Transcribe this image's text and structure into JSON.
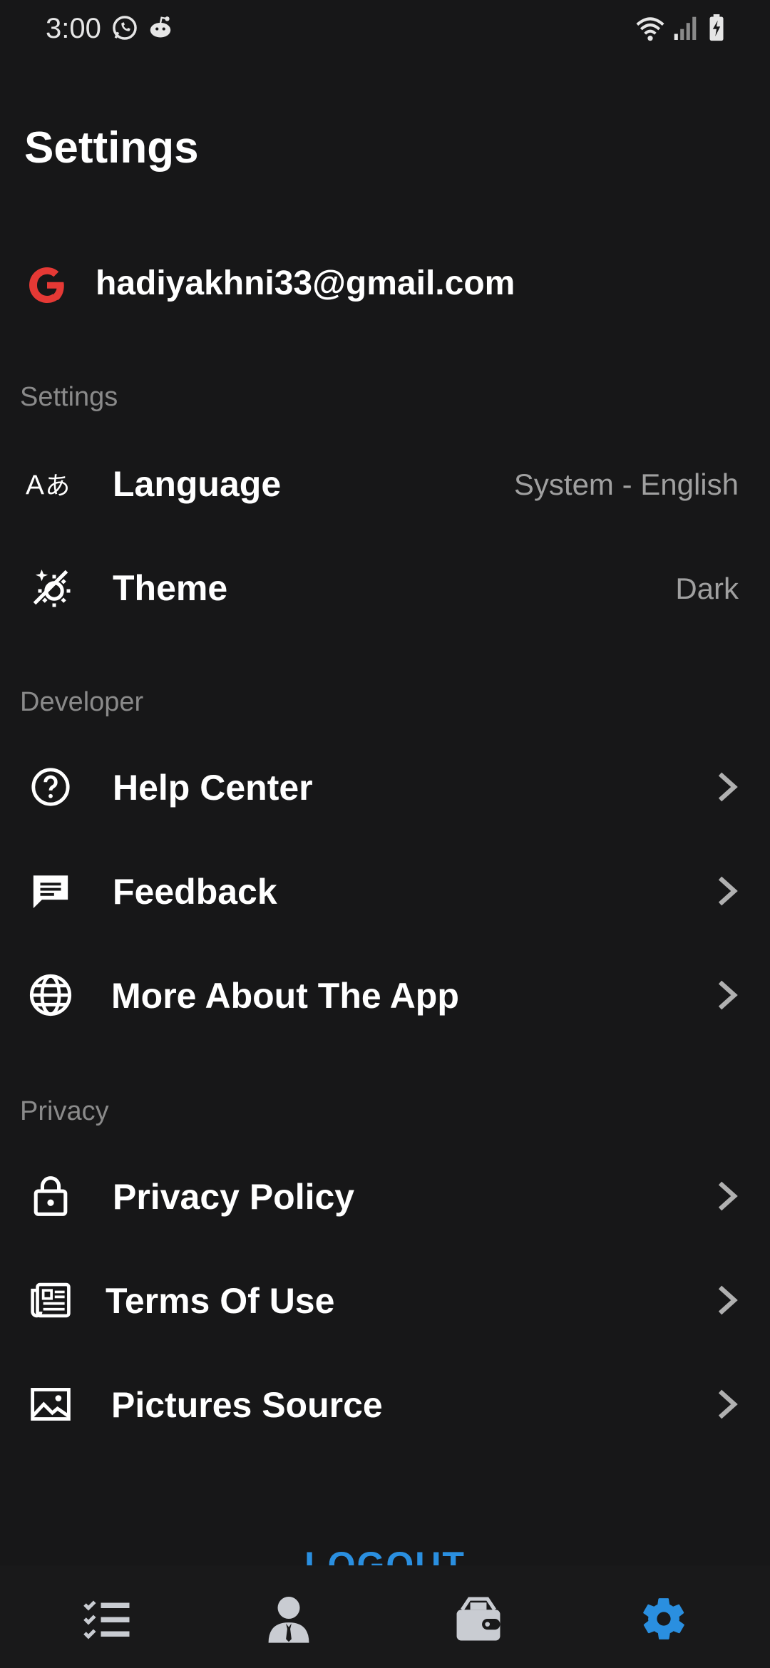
{
  "status_bar": {
    "time": "3:00",
    "left_icons": [
      "whatsapp-icon",
      "reddit-icon"
    ],
    "right_icons": [
      "wifi-icon",
      "signal-icon",
      "battery-charging-icon"
    ]
  },
  "page": {
    "title": "Settings"
  },
  "account": {
    "provider_icon": "google-icon",
    "email": "hadiyakhni33@gmail.com"
  },
  "sections": {
    "settings": {
      "label": "Settings",
      "items": [
        {
          "label": "Language",
          "value": "System - English",
          "icon": "translate-icon"
        },
        {
          "label": "Theme",
          "value": "Dark",
          "icon": "theme-icon"
        }
      ]
    },
    "developer": {
      "label": "Developer",
      "items": [
        {
          "label": "Help Center",
          "icon": "help-circle-icon"
        },
        {
          "label": "Feedback",
          "icon": "feedback-icon"
        },
        {
          "label": "More About The App",
          "icon": "globe-icon"
        }
      ]
    },
    "privacy": {
      "label": "Privacy",
      "items": [
        {
          "label": "Privacy Policy",
          "icon": "lock-icon"
        },
        {
          "label": "Terms Of Use",
          "icon": "newspaper-icon"
        },
        {
          "label": "Pictures Source",
          "icon": "image-icon"
        }
      ]
    }
  },
  "logout": {
    "label": "LOGOUT"
  },
  "bottom_nav": {
    "items": [
      {
        "icon": "checklist-icon",
        "active": false
      },
      {
        "icon": "person-icon",
        "active": false
      },
      {
        "icon": "wallet-icon",
        "active": false
      },
      {
        "icon": "gear-icon",
        "active": true
      }
    ]
  },
  "colors": {
    "background": "#171718",
    "accent": "#2a8fe0",
    "google_red": "#e53935",
    "secondary_text": "#a0a0a0",
    "section_label": "#8a8a8a"
  }
}
